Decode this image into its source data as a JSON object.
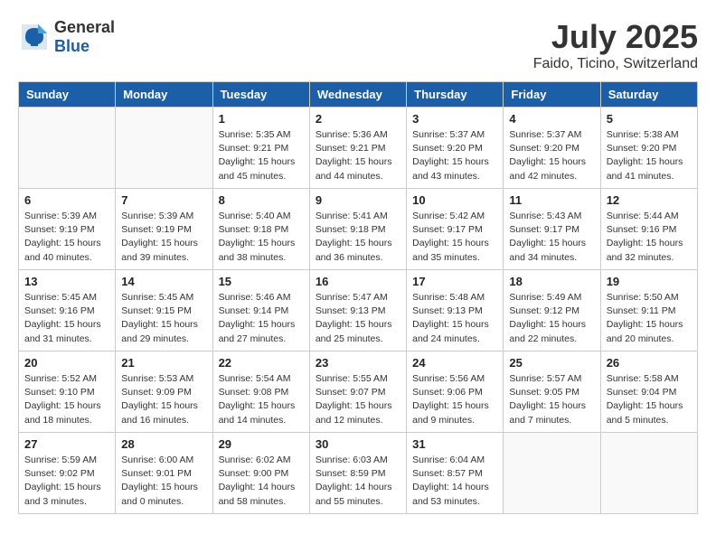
{
  "logo": {
    "general": "General",
    "blue": "Blue"
  },
  "title": "July 2025",
  "subtitle": "Faido, Ticino, Switzerland",
  "headers": [
    "Sunday",
    "Monday",
    "Tuesday",
    "Wednesday",
    "Thursday",
    "Friday",
    "Saturday"
  ],
  "weeks": [
    [
      {
        "day": "",
        "info": ""
      },
      {
        "day": "",
        "info": ""
      },
      {
        "day": "1",
        "info": "Sunrise: 5:35 AM\nSunset: 9:21 PM\nDaylight: 15 hours\nand 45 minutes."
      },
      {
        "day": "2",
        "info": "Sunrise: 5:36 AM\nSunset: 9:21 PM\nDaylight: 15 hours\nand 44 minutes."
      },
      {
        "day": "3",
        "info": "Sunrise: 5:37 AM\nSunset: 9:20 PM\nDaylight: 15 hours\nand 43 minutes."
      },
      {
        "day": "4",
        "info": "Sunrise: 5:37 AM\nSunset: 9:20 PM\nDaylight: 15 hours\nand 42 minutes."
      },
      {
        "day": "5",
        "info": "Sunrise: 5:38 AM\nSunset: 9:20 PM\nDaylight: 15 hours\nand 41 minutes."
      }
    ],
    [
      {
        "day": "6",
        "info": "Sunrise: 5:39 AM\nSunset: 9:19 PM\nDaylight: 15 hours\nand 40 minutes."
      },
      {
        "day": "7",
        "info": "Sunrise: 5:39 AM\nSunset: 9:19 PM\nDaylight: 15 hours\nand 39 minutes."
      },
      {
        "day": "8",
        "info": "Sunrise: 5:40 AM\nSunset: 9:18 PM\nDaylight: 15 hours\nand 38 minutes."
      },
      {
        "day": "9",
        "info": "Sunrise: 5:41 AM\nSunset: 9:18 PM\nDaylight: 15 hours\nand 36 minutes."
      },
      {
        "day": "10",
        "info": "Sunrise: 5:42 AM\nSunset: 9:17 PM\nDaylight: 15 hours\nand 35 minutes."
      },
      {
        "day": "11",
        "info": "Sunrise: 5:43 AM\nSunset: 9:17 PM\nDaylight: 15 hours\nand 34 minutes."
      },
      {
        "day": "12",
        "info": "Sunrise: 5:44 AM\nSunset: 9:16 PM\nDaylight: 15 hours\nand 32 minutes."
      }
    ],
    [
      {
        "day": "13",
        "info": "Sunrise: 5:45 AM\nSunset: 9:16 PM\nDaylight: 15 hours\nand 31 minutes."
      },
      {
        "day": "14",
        "info": "Sunrise: 5:45 AM\nSunset: 9:15 PM\nDaylight: 15 hours\nand 29 minutes."
      },
      {
        "day": "15",
        "info": "Sunrise: 5:46 AM\nSunset: 9:14 PM\nDaylight: 15 hours\nand 27 minutes."
      },
      {
        "day": "16",
        "info": "Sunrise: 5:47 AM\nSunset: 9:13 PM\nDaylight: 15 hours\nand 25 minutes."
      },
      {
        "day": "17",
        "info": "Sunrise: 5:48 AM\nSunset: 9:13 PM\nDaylight: 15 hours\nand 24 minutes."
      },
      {
        "day": "18",
        "info": "Sunrise: 5:49 AM\nSunset: 9:12 PM\nDaylight: 15 hours\nand 22 minutes."
      },
      {
        "day": "19",
        "info": "Sunrise: 5:50 AM\nSunset: 9:11 PM\nDaylight: 15 hours\nand 20 minutes."
      }
    ],
    [
      {
        "day": "20",
        "info": "Sunrise: 5:52 AM\nSunset: 9:10 PM\nDaylight: 15 hours\nand 18 minutes."
      },
      {
        "day": "21",
        "info": "Sunrise: 5:53 AM\nSunset: 9:09 PM\nDaylight: 15 hours\nand 16 minutes."
      },
      {
        "day": "22",
        "info": "Sunrise: 5:54 AM\nSunset: 9:08 PM\nDaylight: 15 hours\nand 14 minutes."
      },
      {
        "day": "23",
        "info": "Sunrise: 5:55 AM\nSunset: 9:07 PM\nDaylight: 15 hours\nand 12 minutes."
      },
      {
        "day": "24",
        "info": "Sunrise: 5:56 AM\nSunset: 9:06 PM\nDaylight: 15 hours\nand 9 minutes."
      },
      {
        "day": "25",
        "info": "Sunrise: 5:57 AM\nSunset: 9:05 PM\nDaylight: 15 hours\nand 7 minutes."
      },
      {
        "day": "26",
        "info": "Sunrise: 5:58 AM\nSunset: 9:04 PM\nDaylight: 15 hours\nand 5 minutes."
      }
    ],
    [
      {
        "day": "27",
        "info": "Sunrise: 5:59 AM\nSunset: 9:02 PM\nDaylight: 15 hours\nand 3 minutes."
      },
      {
        "day": "28",
        "info": "Sunrise: 6:00 AM\nSunset: 9:01 PM\nDaylight: 15 hours\nand 0 minutes."
      },
      {
        "day": "29",
        "info": "Sunrise: 6:02 AM\nSunset: 9:00 PM\nDaylight: 14 hours\nand 58 minutes."
      },
      {
        "day": "30",
        "info": "Sunrise: 6:03 AM\nSunset: 8:59 PM\nDaylight: 14 hours\nand 55 minutes."
      },
      {
        "day": "31",
        "info": "Sunrise: 6:04 AM\nSunset: 8:57 PM\nDaylight: 14 hours\nand 53 minutes."
      },
      {
        "day": "",
        "info": ""
      },
      {
        "day": "",
        "info": ""
      }
    ]
  ]
}
